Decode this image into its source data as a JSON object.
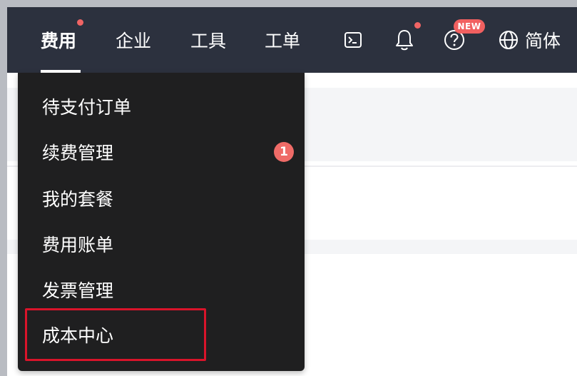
{
  "topnav": {
    "items": [
      {
        "label": "费用",
        "active": true,
        "has_dot": true
      },
      {
        "label": "企业",
        "active": false,
        "has_dot": false
      },
      {
        "label": "工具",
        "active": false,
        "has_dot": false
      },
      {
        "label": "工单",
        "active": false,
        "has_dot": false
      }
    ],
    "icons": [
      {
        "name": "terminal-icon"
      },
      {
        "name": "bell-icon",
        "has_dot": true
      },
      {
        "name": "help-icon",
        "badge": "NEW"
      },
      {
        "name": "globe-icon"
      }
    ],
    "new_badge": "NEW",
    "language_label": "简体"
  },
  "dropdown": {
    "items": [
      {
        "label": "待支付订单"
      },
      {
        "label": "续费管理",
        "badge": "1"
      },
      {
        "label": "我的套餐"
      },
      {
        "label": "费用账单"
      },
      {
        "label": "发票管理"
      },
      {
        "label": "成本中心",
        "highlighted": true
      }
    ]
  },
  "colors": {
    "topbar_bg": "#2c313e",
    "dropdown_bg": "#1f1f20",
    "badge_red": "#f06464",
    "highlight_border": "#d9142a"
  }
}
